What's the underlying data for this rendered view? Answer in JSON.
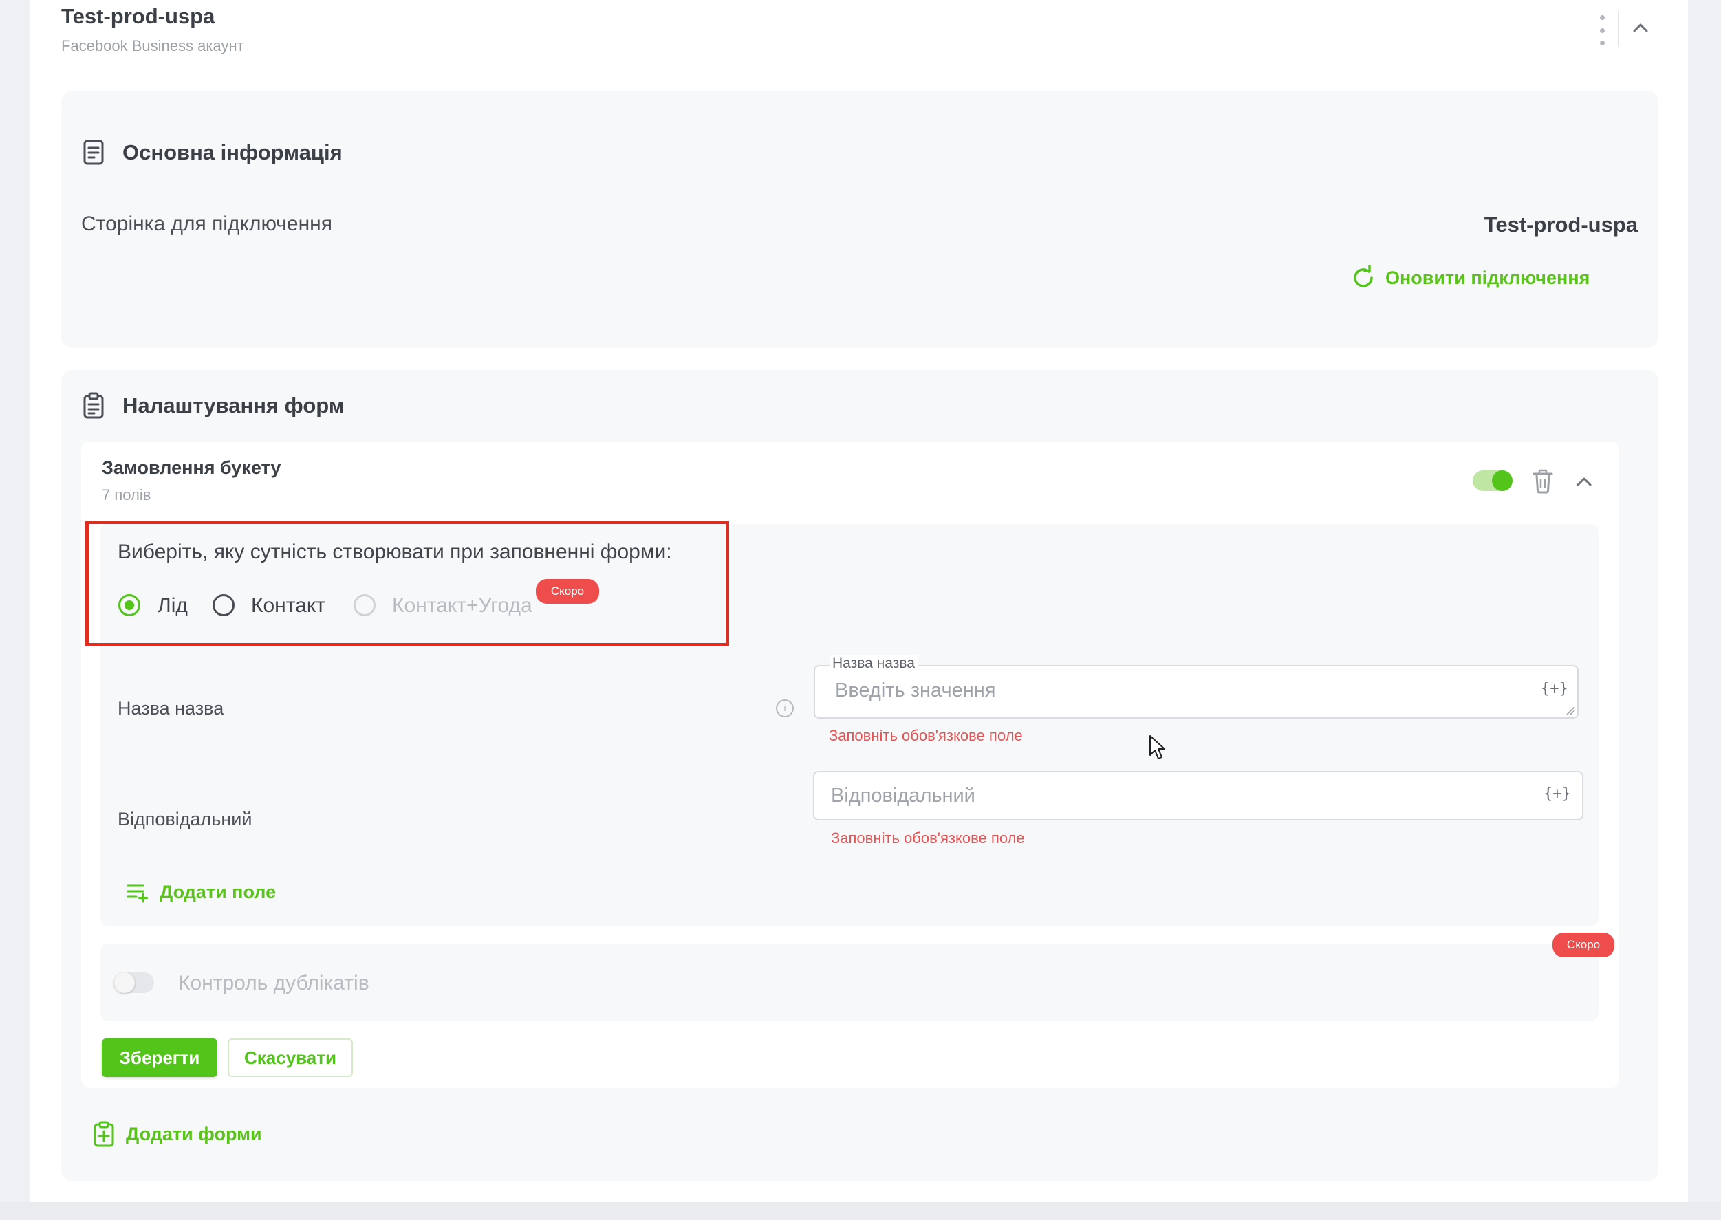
{
  "header": {
    "title": "Test-prod-uspa",
    "subtitle": "Facebook Business акаунт"
  },
  "basic_info": {
    "title": "Основна інформація",
    "page_label": "Сторінка для підключення",
    "page_value": "Test-prod-uspa",
    "refresh_label": "Оновити підключення"
  },
  "forms_settings": {
    "title": "Налаштування форм",
    "form": {
      "name": "Замовлення букету",
      "fields_count": "7 полів",
      "enabled": true,
      "entity_question": "Виберіть, яку сутність створювати при заповненні форми:",
      "options": [
        {
          "label": "Лід",
          "selected": true,
          "disabled": false
        },
        {
          "label": "Контакт",
          "selected": false,
          "disabled": false
        },
        {
          "label": "Контакт+Угода",
          "selected": false,
          "disabled": true
        }
      ],
      "soon_badge": "Скоро",
      "fields": [
        {
          "label": "Назва назва",
          "legend": "Назва назва",
          "placeholder": "Введіть значення",
          "var_button": "{+}",
          "error": "Заповніть обов'язкове поле"
        },
        {
          "label": "Відповідальний",
          "placeholder": "Відповідальний",
          "var_button": "{+}",
          "error": "Заповніть обов'язкове поле"
        }
      ],
      "add_field_label": "Додати поле",
      "duplicates_label": "Контроль дублікатів",
      "duplicates_enabled": false,
      "duplicates_badge": "Скоро",
      "save_label": "Зберегти",
      "cancel_label": "Скасувати"
    },
    "add_forms_label": "Додати форми"
  },
  "colors": {
    "accent": "#52c41a",
    "error": "#e55353",
    "badge": "#ef4c4c",
    "highlight": "#e12d1f"
  }
}
